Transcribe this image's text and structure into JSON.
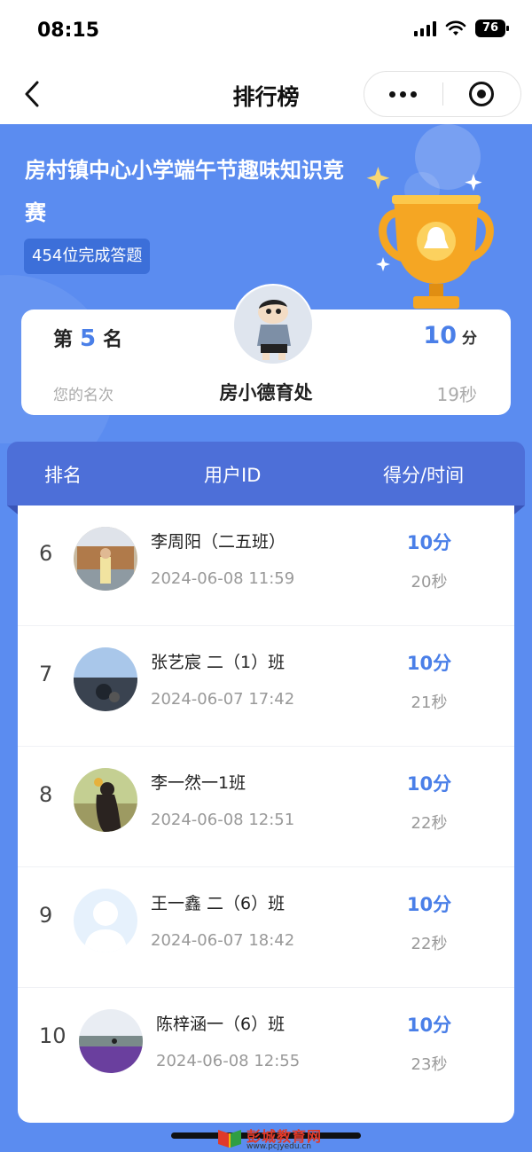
{
  "status_bar": {
    "time": "08:15",
    "battery": "76"
  },
  "nav": {
    "title": "排行榜"
  },
  "hero": {
    "event_title": "房村镇中心小学端午节趣味知识竞赛",
    "completion_text": "454位完成答题"
  },
  "my_rank": {
    "prefix": "第",
    "rank": "5",
    "suffix": "名",
    "caption": "您的名次",
    "name": "房小德育处",
    "score": "10",
    "score_unit": "分",
    "time": "19秒"
  },
  "table": {
    "col_rank": "排名",
    "col_user": "用户ID",
    "col_score": "得分/时间",
    "rows": [
      {
        "rank": "6",
        "name": "李周阳（二五班）",
        "date": "2024-06-08 11:59",
        "score": "10分",
        "secs": "20秒"
      },
      {
        "rank": "7",
        "name": "张艺宸 二（1）班",
        "date": "2024-06-07 17:42",
        "score": "10分",
        "secs": "21秒"
      },
      {
        "rank": "8",
        "name": "李一然一1班",
        "date": "2024-06-08 12:51",
        "score": "10分",
        "secs": "22秒"
      },
      {
        "rank": "9",
        "name": "王一鑫 二（6）班",
        "date": "2024-06-07 18:42",
        "score": "10分",
        "secs": "22秒"
      },
      {
        "rank": "10",
        "name": "陈梓涵一（6）班",
        "date": "2024-06-08 12:55",
        "score": "10分",
        "secs": "23秒"
      }
    ]
  },
  "watermark": {
    "text": "彭城教育网",
    "url": "www.pcjyedu.cn"
  },
  "colors": {
    "accent": "#4a7fe8",
    "background": "#5b8cf0",
    "header": "#4d6fd8",
    "trophy": "#f5a623"
  },
  "icons": {
    "back": "chevron-left-icon",
    "more": "more-dots-icon",
    "close": "target-icon"
  }
}
